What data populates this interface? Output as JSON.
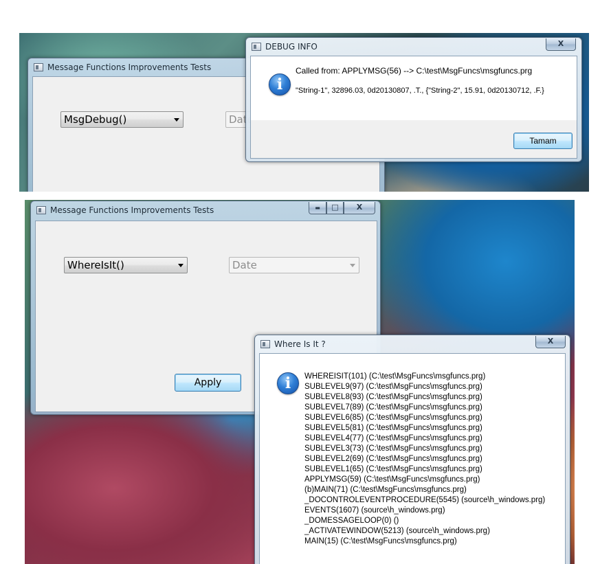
{
  "top_screenshot": {
    "main_window": {
      "title": "Message Functions Improvements Tests",
      "function_combo_value": "MsgDebug()",
      "type_combo_value": "Date"
    },
    "debug_dialog": {
      "title": "DEBUG INFO",
      "called_from": "Called from: APPLYMSG(56) --> C:\\test\\MsgFuncs\\msgfuncs.prg",
      "values_line": "\"String-1\", 32896.03, 0d20130807, .T., {\"String-2\", 15.91, 0d20130712, .F.}",
      "ok_button": "Tamam",
      "close_glyph": "X",
      "icon": "information-icon"
    }
  },
  "bottom_screenshot": {
    "main_window": {
      "title": "Message Functions Improvements Tests",
      "function_combo_value": "WhereIsIt()",
      "type_combo_value": "Date",
      "apply_button": "Apply",
      "minimize_glyph": "▬",
      "maximize_glyph": "□",
      "close_glyph": "X"
    },
    "whereisit_dialog": {
      "title": "Where Is It ?",
      "close_glyph": "X",
      "icon": "information-icon",
      "trace": [
        "WHEREISIT(101) (C:\\test\\MsgFuncs\\msgfuncs.prg)",
        "SUBLEVEL9(97) (C:\\test\\MsgFuncs\\msgfuncs.prg)",
        "SUBLEVEL8(93) (C:\\test\\MsgFuncs\\msgfuncs.prg)",
        "SUBLEVEL7(89) (C:\\test\\MsgFuncs\\msgfuncs.prg)",
        "SUBLEVEL6(85) (C:\\test\\MsgFuncs\\msgfuncs.prg)",
        "SUBLEVEL5(81) (C:\\test\\MsgFuncs\\msgfuncs.prg)",
        "SUBLEVEL4(77) (C:\\test\\MsgFuncs\\msgfuncs.prg)",
        "SUBLEVEL3(73) (C:\\test\\MsgFuncs\\msgfuncs.prg)",
        "SUBLEVEL2(69) (C:\\test\\MsgFuncs\\msgfuncs.prg)",
        "SUBLEVEL1(65) (C:\\test\\MsgFuncs\\msgfuncs.prg)",
        "APPLYMSG(59) (C:\\test\\MsgFuncs\\msgfuncs.prg)",
        "(b)MAIN(71) (C:\\test\\MsgFuncs\\msgfuncs.prg)",
        "_DOCONTROLEVENTPROCEDURE(5545) (source\\h_windows.prg)",
        "EVENTS(1607) (source\\h_windows.prg)",
        "_DOMESSAGELOOP(0) ()",
        "_ACTIVATEWINDOW(5213) (source\\h_windows.prg)",
        "MAIN(15) (C:\\test\\MsgFuncs\\msgfuncs.prg)"
      ]
    }
  }
}
